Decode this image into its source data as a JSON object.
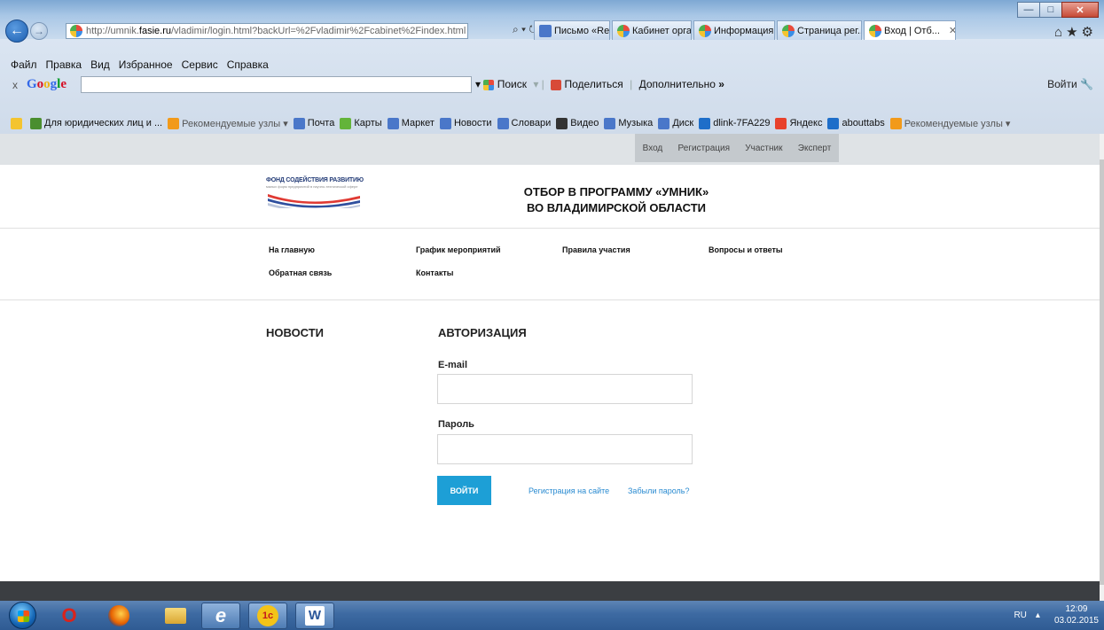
{
  "browser": {
    "url_prefix": "http://umnik.",
    "url_domain": "fasie.ru",
    "url_suffix": "/vladimir/login.html?backUrl=%2Fvladimir%2Fcabinet%2Findex.html",
    "addr_tools": "⌕ ▾ ↻",
    "tabs": [
      {
        "label": "Письмо «Re: ..."
      },
      {
        "label": "Кабинет орга..."
      },
      {
        "label": "Информация ..."
      },
      {
        "label": "Страница рег..."
      },
      {
        "label": "Вход | Отб..."
      }
    ],
    "menu": [
      "Файл",
      "Правка",
      "Вид",
      "Избранное",
      "Сервис",
      "Справка"
    ],
    "google": {
      "close": "x",
      "logo": "Google",
      "search_button": "Поиск",
      "share": "Поделиться",
      "more": "Дополнительно",
      "login": "Войти"
    },
    "favorites": [
      {
        "label": "Для юридических лиц и ...",
        "color": "#4a8e2f"
      },
      {
        "label": "Рекомендуемые узлы ▾",
        "color": "#f29a1a",
        "muted": true
      },
      {
        "label": "Почта",
        "color": "#4a77c9"
      },
      {
        "label": "Карты",
        "color": "#63b43a"
      },
      {
        "label": "Маркет",
        "color": "#4a77c9"
      },
      {
        "label": "Новости",
        "color": "#4a77c9"
      },
      {
        "label": "Словари",
        "color": "#4a77c9"
      },
      {
        "label": "Видео",
        "color": "#333333"
      },
      {
        "label": "Музыка",
        "color": "#4a77c9"
      },
      {
        "label": "Диск",
        "color": "#4a77c9"
      },
      {
        "label": "dlink-7FA229",
        "color": "#1e6ec9"
      },
      {
        "label": "Яндекс",
        "color": "#e8412c"
      },
      {
        "label": "abouttabs",
        "color": "#1e6ec9"
      },
      {
        "label": "Рекомендуемые узлы ▾",
        "color": "#f29a1a",
        "muted": true
      }
    ]
  },
  "auth_nav": [
    "Вход",
    "Регистрация",
    "Участник",
    "Эксперт"
  ],
  "logo": {
    "name": "ФОНД СОДЕЙСТВИЯ РАЗВИТИЮ",
    "sub": "малых форм предприятий в научно-технической сфере"
  },
  "site_title": {
    "line1": "ОТБОР В ПРОГРАММУ «УМНИК»",
    "line2": "ВО ВЛАДИМИРСКОЙ ОБЛАСТИ"
  },
  "nav": [
    "На главную",
    "График мероприятий",
    "Правила участия",
    "Вопросы и ответы",
    "Обратная связь",
    "Контакты"
  ],
  "news_heading": "НОВОСТИ",
  "auth": {
    "heading": "АВТОРИЗАЦИЯ",
    "email_label": "E-mail",
    "email_value": "",
    "password_label": "Пароль",
    "password_value": "",
    "submit": "войти",
    "register_link": "Регистрация на сайте",
    "forgot_link": "Забыли пароль?"
  },
  "taskbar": {
    "lang": "RU",
    "time": "12:09",
    "date": "03.02.2015"
  },
  "colors": {
    "accent": "#1d9fd6",
    "link": "#2a8bd1",
    "footer": "#3b3e42"
  }
}
